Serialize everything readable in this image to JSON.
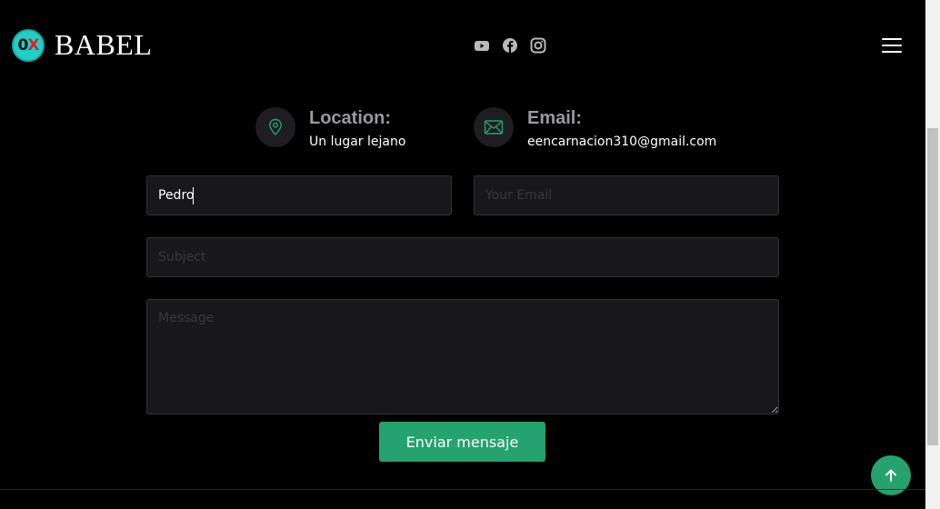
{
  "header": {
    "logo_zero": "0",
    "logo_x": "X",
    "brand": "BABEL",
    "socials": [
      "youtube-icon",
      "facebook-icon",
      "instagram-icon"
    ]
  },
  "info": {
    "location_title": "Location:",
    "location_value": "Un lugar lejano",
    "email_title": "Email:",
    "email_value": "eencarnacion310@gmail.com"
  },
  "form": {
    "name_value": "Pedro",
    "email_placeholder": "Your Email",
    "subject_placeholder": "Subject",
    "message_placeholder": "Message",
    "submit_label": "Enviar mensaje"
  },
  "colors": {
    "accent": "#25a36f",
    "background": "#000000",
    "field_bg": "#18181b"
  }
}
